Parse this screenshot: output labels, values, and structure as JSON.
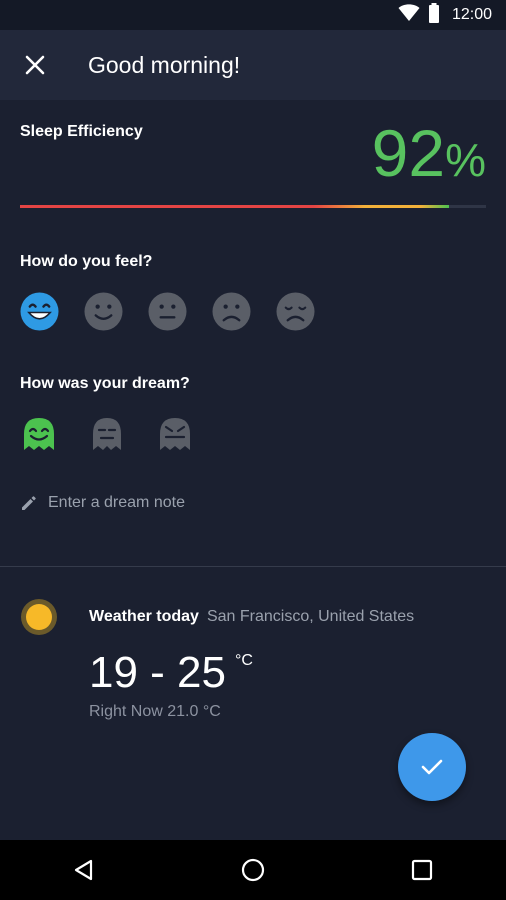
{
  "status": {
    "time": "12:00"
  },
  "appbar": {
    "title": "Good morning!"
  },
  "efficiency": {
    "label": "Sleep Efficiency",
    "value": "92",
    "unit": "%",
    "fraction": 0.92
  },
  "feel": {
    "question": "How do you feel?",
    "options": [
      "very-happy",
      "happy",
      "neutral",
      "sad",
      "very-sad"
    ],
    "selected": "very-happy"
  },
  "dream": {
    "question": "How was your dream?",
    "options": [
      "good",
      "neutral",
      "bad"
    ],
    "selected": "good",
    "note_placeholder": "Enter a dream note"
  },
  "weather": {
    "title": "Weather today",
    "location": "San Francisco, United States",
    "range": "19 - 25",
    "unit": "°C",
    "right_now": "Right Now 21.0 °C"
  },
  "colors": {
    "accent": "#3e98ea",
    "efficiency_green": "#58c25f",
    "selected_feel": "#2e9ae4",
    "selected_dream": "#4cc24f",
    "inactive_icon": "#5a5e67",
    "background": "#1b2030"
  }
}
